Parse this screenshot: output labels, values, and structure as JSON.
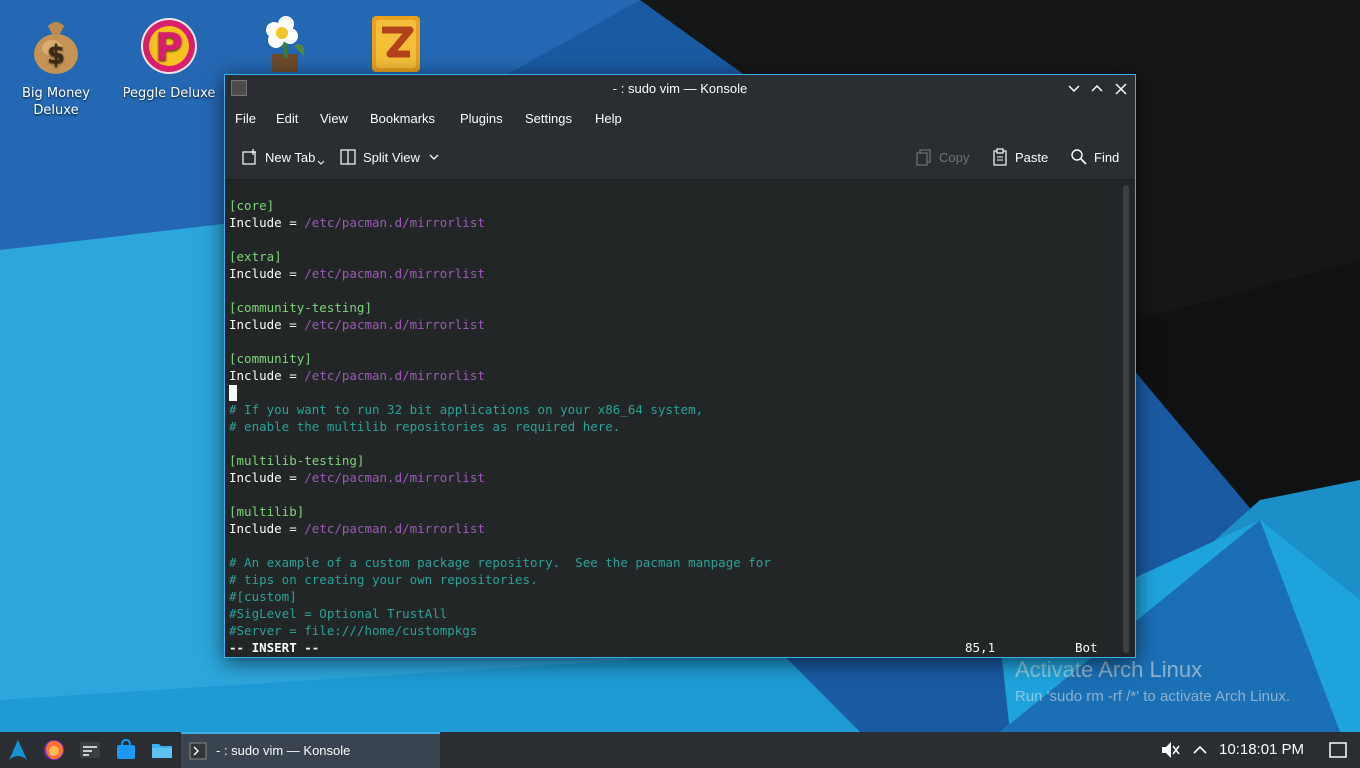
{
  "desktop": {
    "icons": [
      {
        "label": "Big Money\nDeluxe"
      },
      {
        "label": "Peggle Deluxe"
      },
      {
        "label": ""
      },
      {
        "label": ""
      }
    ],
    "watermark": {
      "title": "Activate Arch Linux",
      "subtitle": "Run 'sudo rm -rf /*' to activate Arch Linux."
    }
  },
  "window": {
    "title": "- : sudo vim — Konsole",
    "menu": [
      "File",
      "Edit",
      "View",
      "Bookmarks",
      "Plugins",
      "Settings",
      "Help"
    ],
    "toolbar": {
      "new_tab": "New Tab",
      "split_view": "Split View",
      "copy": "Copy",
      "paste": "Paste",
      "find": "Find"
    }
  },
  "terminal": {
    "lines": [
      {
        "text": "[core]",
        "kind": "sec"
      },
      {
        "k": "Include = ",
        "p": "/etc/pacman.d/mirrorlist"
      },
      {
        "text": "",
        "kind": "blank"
      },
      {
        "text": "[extra]",
        "kind": "sec"
      },
      {
        "k": "Include = ",
        "p": "/etc/pacman.d/mirrorlist"
      },
      {
        "text": "",
        "kind": "blank"
      },
      {
        "text": "[community-testing]",
        "kind": "sec"
      },
      {
        "k": "Include = ",
        "p": "/etc/pacman.d/mirrorlist"
      },
      {
        "text": "",
        "kind": "blank"
      },
      {
        "text": "[community]",
        "kind": "sec"
      },
      {
        "k": "Include = ",
        "p": "/etc/pacman.d/mirrorlist"
      },
      {
        "text": "",
        "kind": "cursor"
      },
      {
        "text": "# If you want to run 32 bit applications on your x86_64 system,",
        "kind": "cmt"
      },
      {
        "text": "# enable the multilib repositories as required here.",
        "kind": "cmt"
      },
      {
        "text": "",
        "kind": "blank"
      },
      {
        "text": "[multilib-testing]",
        "kind": "sec"
      },
      {
        "k": "Include = ",
        "p": "/etc/pacman.d/mirrorlist"
      },
      {
        "text": "",
        "kind": "blank"
      },
      {
        "text": "[multilib]",
        "kind": "sec"
      },
      {
        "k": "Include = ",
        "p": "/etc/pacman.d/mirrorlist"
      },
      {
        "text": "",
        "kind": "blank"
      },
      {
        "text": "# An example of a custom package repository.  See the pacman manpage for",
        "kind": "cmt"
      },
      {
        "text": "# tips on creating your own repositories.",
        "kind": "cmt"
      },
      {
        "text": "#[custom]",
        "kind": "cmt"
      },
      {
        "text": "#SigLevel = Optional TrustAll",
        "kind": "cmt"
      },
      {
        "text": "#Server = file:///home/custompkgs",
        "kind": "cmt"
      }
    ],
    "status": {
      "mode": "-- INSERT --",
      "position": "85,1",
      "scroll": "Bot"
    }
  },
  "taskbar": {
    "task_label": "- : sudo vim — Konsole",
    "clock": "10:18:01 PM"
  },
  "colors": {
    "accent": "#3daee9",
    "section": "#7ed37a",
    "path": "#9b59b6",
    "comment": "#2aa197"
  }
}
